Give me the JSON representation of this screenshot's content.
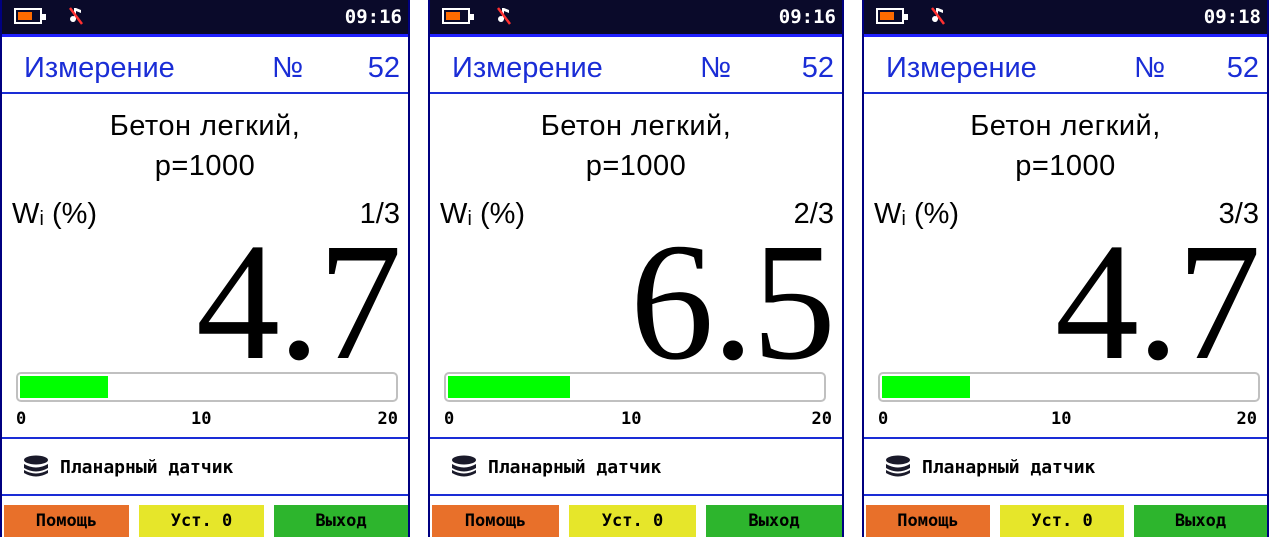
{
  "colors": {
    "title_blue": "#1a2dd6",
    "status_bg": "#0a0a2a",
    "battery_orange": "#ff6a00",
    "bar_green": "#00ff00",
    "help_btn": "#e8702a",
    "zero_btn": "#e6e62a",
    "exit_btn": "#2db52d"
  },
  "icons": {
    "battery": "battery-icon",
    "mute": "sound-off-icon",
    "sensor": "database-stack-icon"
  },
  "screens": [
    {
      "time": "09:16",
      "title": "Измерение",
      "number_sign": "№",
      "number": "52",
      "material_line1": "Бетон  легкий,",
      "material_line2": "р=1000",
      "wi_label": "Wᵢ (%)",
      "counter": "1/3",
      "value": "4.7",
      "bar_fraction": 0.235,
      "scale": [
        "0",
        "10",
        "20"
      ],
      "sensor": "Планарный  датчик",
      "buttons": {
        "help": "Помощь",
        "zero": "Уст. 0",
        "exit": "Выход"
      }
    },
    {
      "time": "09:16",
      "title": "Измерение",
      "number_sign": "№",
      "number": "52",
      "material_line1": "Бетон  легкий,",
      "material_line2": "р=1000",
      "wi_label": "Wᵢ (%)",
      "counter": "2/3",
      "value": "6.5",
      "bar_fraction": 0.325,
      "scale": [
        "0",
        "10",
        "20"
      ],
      "sensor": "Планарный  датчик",
      "buttons": {
        "help": "Помощь",
        "zero": "Уст. 0",
        "exit": "Выход"
      }
    },
    {
      "time": "09:18",
      "title": "Измерение",
      "number_sign": "№",
      "number": "52",
      "material_line1": "Бетон  легкий,",
      "material_line2": "р=1000",
      "wi_label": "Wᵢ (%)",
      "counter": "3/3",
      "value": "4.7",
      "bar_fraction": 0.235,
      "scale": [
        "0",
        "10",
        "20"
      ],
      "sensor": "Планарный  датчик",
      "buttons": {
        "help": "Помощь",
        "zero": "Уст. 0",
        "exit": "Выход"
      }
    }
  ]
}
